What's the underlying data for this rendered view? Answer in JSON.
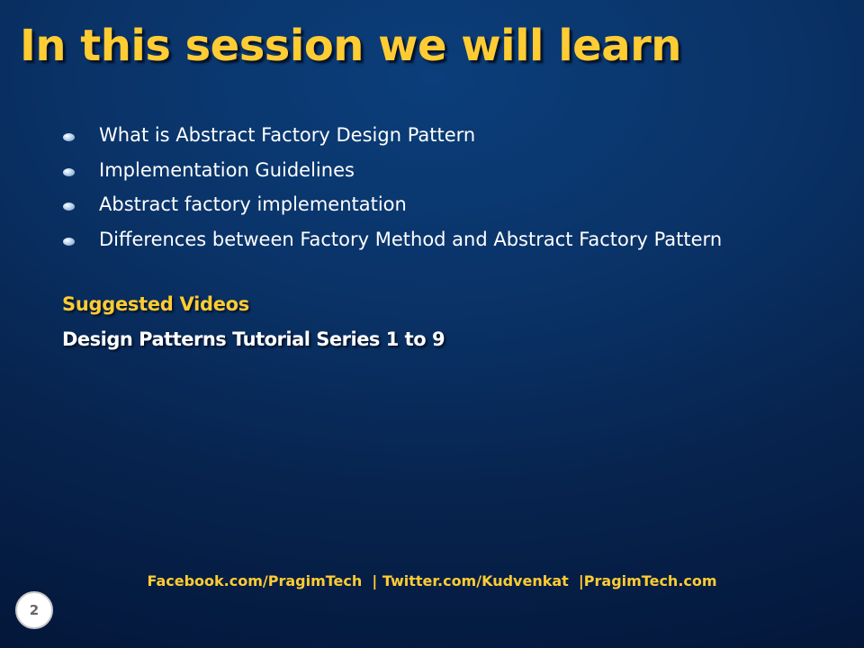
{
  "slide": {
    "title": "In this session we will learn",
    "bullets": [
      "What is Abstract Factory Design Pattern",
      "Implementation Guidelines",
      "Abstract factory implementation",
      "Differences between Factory Method and Abstract Factory Pattern"
    ],
    "suggested_heading": "Suggested Videos",
    "suggested_item": "Design Patterns Tutorial Series 1 to 9",
    "footer": "Facebook.com/PragimTech  | Twitter.com/Kudvenkat  |PragimTech.com",
    "page_number": "2"
  },
  "colors": {
    "title": "#ffcc33",
    "background": "#0a3368",
    "body_text": "#ffffff"
  }
}
